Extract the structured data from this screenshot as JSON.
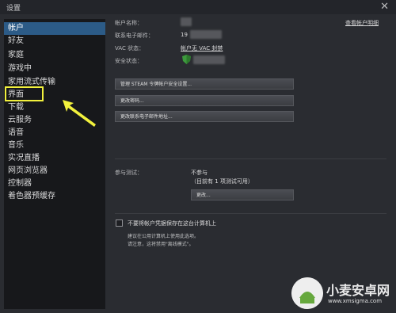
{
  "window": {
    "title": "设置",
    "close_glyph": "✕"
  },
  "sidebar": {
    "items": [
      {
        "label": "帐户",
        "active": true
      },
      {
        "label": "好友"
      },
      {
        "label": "家庭"
      },
      {
        "label": "游戏中"
      },
      {
        "label": "家用流式传输"
      },
      {
        "label": "界面"
      },
      {
        "label": "下载"
      },
      {
        "label": "云服务"
      },
      {
        "label": "语音"
      },
      {
        "label": "音乐"
      },
      {
        "label": "实况直播"
      },
      {
        "label": "网页浏览器"
      },
      {
        "label": "控制器"
      },
      {
        "label": "着色器预缓存"
      }
    ]
  },
  "account": {
    "name_label": "帐户名称：",
    "email_label": "联系电子邮件：",
    "email_value": "19",
    "vac_label": "VAC 状态：",
    "vac_value": "帐户无 VAC 封禁",
    "security_label": "安全状态：",
    "view_details": "查看帐户明细",
    "btn_manage": "管理 STEAM 令牌帐户安全设置...",
    "btn_change_password": "更改密码...",
    "btn_change_email": "更改联系电子邮件地址..."
  },
  "beta": {
    "label": "参与测试：",
    "value": "不参与",
    "sub": "（目前有 1 项测试可用）",
    "btn_change": "更改..."
  },
  "remember": {
    "checkbox_label": "不要将帐户凭据保存在这台计算机上",
    "note_line1": "建议在公用计算机上使用此选项。",
    "note_line2": "请注意，这将禁用\"离线模式\"。"
  },
  "watermark": {
    "text": "小麦安卓网",
    "url": "www.xmsigma.com"
  },
  "colors": {
    "active_item": "#2c5b87",
    "highlight": "#f2f13d",
    "shield": "#3d9a3d"
  }
}
